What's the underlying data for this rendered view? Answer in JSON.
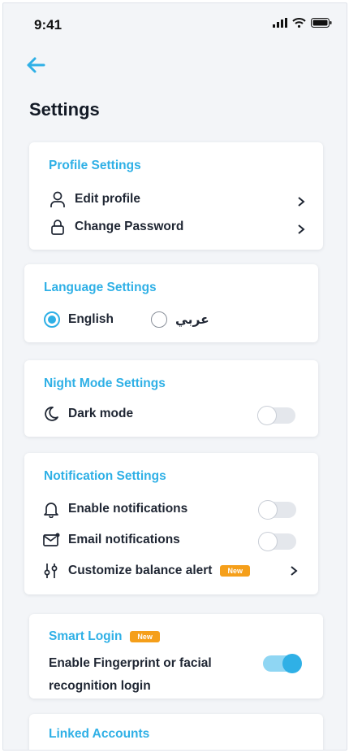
{
  "status": {
    "time": "9:41"
  },
  "page": {
    "title": "Settings"
  },
  "profile": {
    "title": "Profile Settings",
    "items": [
      {
        "label": "Edit profile",
        "icon": "user-icon"
      },
      {
        "label": "Change Password",
        "icon": "lock-icon"
      }
    ]
  },
  "language": {
    "title": "Language Settings",
    "options": [
      {
        "label": "English",
        "selected": true
      },
      {
        "label": "عربي",
        "selected": false
      }
    ]
  },
  "night": {
    "title": "Night Mode Settings",
    "label": "Dark mode",
    "enabled": false
  },
  "notifications": {
    "title": "Notification Settings",
    "items": [
      {
        "label": "Enable notifications",
        "icon": "bell-icon",
        "enabled": false
      },
      {
        "label": "Email notifications",
        "icon": "mail-icon",
        "enabled": false
      },
      {
        "label": "Customize balance alert",
        "icon": "sliders-icon",
        "badge": "New"
      }
    ]
  },
  "smart_login": {
    "title": "Smart Login",
    "badge": "New",
    "line1": "Enable Fingerprint or facial",
    "line2": "recognition login",
    "enabled": true
  },
  "linked": {
    "title": "Linked Accounts"
  },
  "colors": {
    "accent": "#2fb0e6",
    "badge": "#f59f1a",
    "background": "#f3f5f8"
  }
}
